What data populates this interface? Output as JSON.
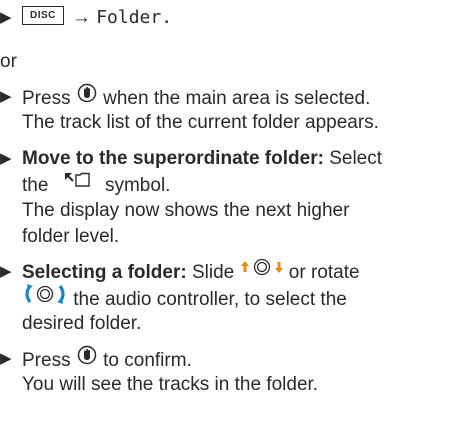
{
  "lines": {
    "l1": {
      "button": "DISC",
      "arrow": "→",
      "target": "Folder."
    },
    "l2": "or",
    "l3a": "Press",
    "l3b": "when the main area is selected.",
    "l4": "The track list of the current folder appears.",
    "l5_bold": "Move to the superordinate folder:",
    "l5_rest": " Select",
    "l6a": "the",
    "l6b": "symbol.",
    "l7": "The display now shows the next higher",
    "l8": "folder level.",
    "l9_bold": "Selecting a folder:",
    "l9a": " Slide",
    "l9b": "or rotate",
    "l10": "the audio controller, to select the",
    "l11": "desired folder.",
    "l12a": "Press",
    "l12b": "to confirm.",
    "l13": "You will see the tracks in the folder."
  },
  "icons": [
    "press-controller-icon",
    "folder-up-icon",
    "slide-controller-icon",
    "rotate-controller-icon"
  ],
  "colors": {
    "text": "#2a2a2a",
    "slide_arrows": "#e8891a",
    "rotate_arrows": "#1a86c8"
  }
}
